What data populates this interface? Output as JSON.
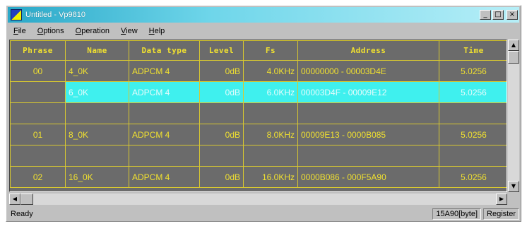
{
  "window": {
    "title": "Untitled - Vp9810"
  },
  "menu": {
    "items": [
      {
        "first": "F",
        "rest": "ile"
      },
      {
        "first": "O",
        "rest": "ptions"
      },
      {
        "first": "O",
        "rest": "peration"
      },
      {
        "first": "V",
        "rest": "iew"
      },
      {
        "first": "H",
        "rest": "elp"
      }
    ]
  },
  "grid": {
    "columns": [
      "Phrase",
      "Name",
      "Data type",
      "Level",
      "Fs",
      "Address",
      "Time"
    ],
    "rows": [
      {
        "phrase": "00",
        "name": "4_0K",
        "type": "ADPCM 4",
        "level": "0dB",
        "fs": "4.0KHz",
        "address": "00000000 - 00003D4E",
        "time": "5.0256"
      },
      {
        "phrase": "",
        "name": "6_0K",
        "type": "ADPCM 4",
        "level": "0dB",
        "fs": "6.0KHz",
        "address": "00003D4F - 00009E12",
        "time": "5.0256",
        "selected": true
      },
      {
        "phrase": "",
        "name": "",
        "type": "",
        "level": "",
        "fs": "",
        "address": "",
        "time": "",
        "empty": true
      },
      {
        "phrase": "01",
        "name": "8_0K",
        "type": "ADPCM 4",
        "level": "0dB",
        "fs": "8.0KHz",
        "address": "00009E13 - 0000B085",
        "time": "5.0256"
      },
      {
        "phrase": "",
        "name": "",
        "type": "",
        "level": "",
        "fs": "",
        "address": "",
        "time": "",
        "empty": true
      },
      {
        "phrase": "02",
        "name": "16_0K",
        "type": "ADPCM 4",
        "level": "0dB",
        "fs": "16.0KHz",
        "address": "0000B086 - 000F5A90",
        "time": "5.0256"
      }
    ]
  },
  "status": {
    "text": "Ready",
    "bytes": "15A90[byte]",
    "register": "Register"
  },
  "colors": {
    "grid_bg": "#6b6b6b",
    "grid_text": "#f0e030",
    "selection": "#3ff0ee",
    "titlebar": "#2aa8c8"
  }
}
